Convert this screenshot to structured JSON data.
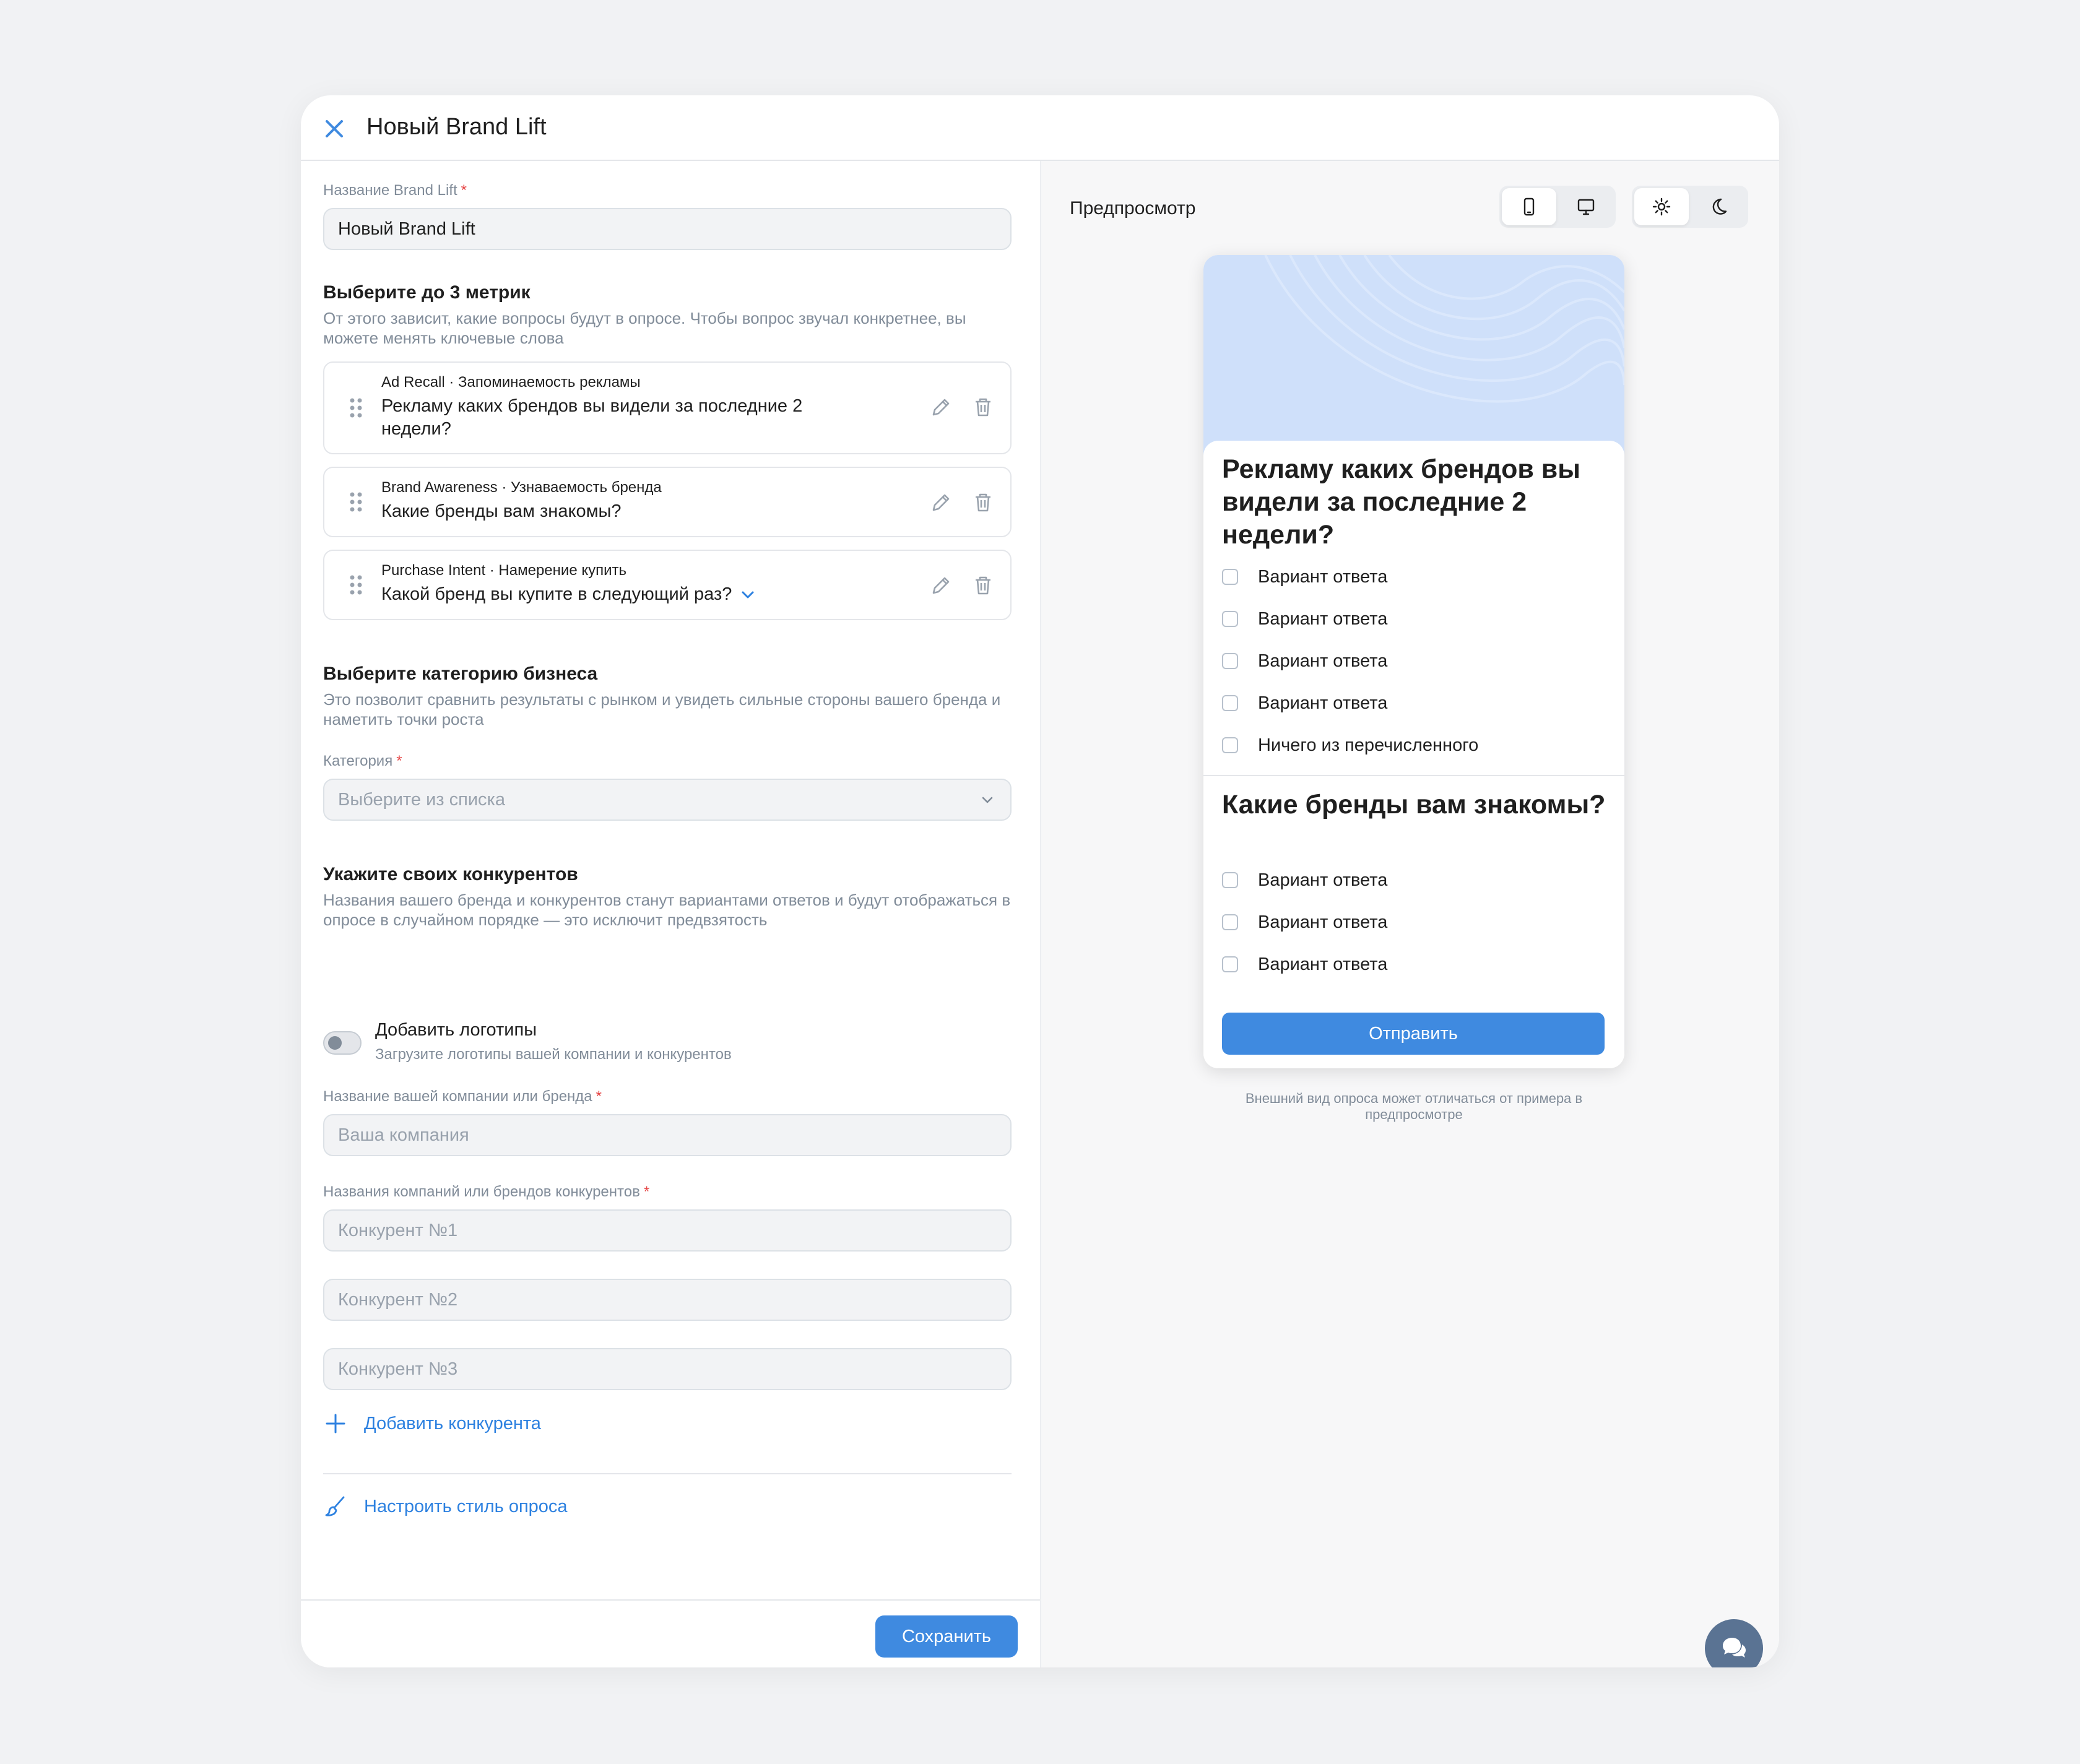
{
  "header": {
    "title": "Новый Brand Lift",
    "close_icon": "close-icon"
  },
  "form": {
    "name_label": "Название Brand Lift",
    "required_mark": "*",
    "name_value": "Новый Brand Lift",
    "metrics_title": "Выберите до 3 метрик",
    "metrics_desc": "От этого зависит, какие вопросы будут в опросе. Чтобы вопрос звучал конкретнее, вы можете менять ключевые слова",
    "metrics": [
      {
        "subtitle": "Ad Recall · Запоминаемость рекламы",
        "question": "Рекламу каких брендов вы видели за последние 2 недели?"
      },
      {
        "subtitle": "Brand Awareness · Узнаваемость бренда",
        "question": "Какие бренды вам знакомы?"
      },
      {
        "subtitle": "Purchase Intent · Намерение купить",
        "question": "Какой бренд вы купите в следующий раз?"
      }
    ],
    "category_title": "Выберите категорию бизнеса",
    "category_desc": "Это позволит сравнить результаты с рынком и увидеть сильные стороны вашего бренда и наметить точки роста",
    "category_label": "Категория",
    "category_placeholder": "Выберите из списка",
    "competitors_title": "Укажите своих конкурентов",
    "competitors_desc": "Названия вашего бренда и конкурентов станут вариантами ответов и будут отображаться в опросе в случайном порядке — это исключит предвзятость",
    "logos_toggle_label": "Добавить логотипы",
    "logos_toggle_desc": "Загрузите логотипы вашей компании и конкурентов",
    "logos_toggle_on": false,
    "company_label": "Название вашей компании или бренда",
    "company_placeholder": "Ваша компания",
    "competitor_names_label": "Названия компаний или брендов конкурентов",
    "competitor_placeholders": [
      "Конкурент №1",
      "Конкурент №2",
      "Конкурент №3"
    ],
    "add_competitor": "Добавить конкурента",
    "customize_style": "Настроить стиль опроса",
    "save": "Сохранить"
  },
  "preview": {
    "title": "Предпросмотр",
    "device_selected": "mobile",
    "theme_selected": "light",
    "questions": [
      {
        "text": "Рекламу каких брендов вы видели за последние 2 недели?",
        "options": [
          "Вариант ответа",
          "Вариант ответа",
          "Вариант ответа",
          "Вариант ответа",
          "Ничего из перечисленного"
        ]
      },
      {
        "text": "Какие бренды вам знакомы?",
        "options": [
          "Вариант ответа",
          "Вариант ответа",
          "Вариант ответа"
        ]
      }
    ],
    "submit": "Отправить",
    "note": "Внешний вид опроса может отличаться от примера в предпросмотре"
  },
  "colors": {
    "accent": "#3f8ae0",
    "link": "#2d81e0",
    "required": "#e64646",
    "fab": "#5a7393"
  }
}
